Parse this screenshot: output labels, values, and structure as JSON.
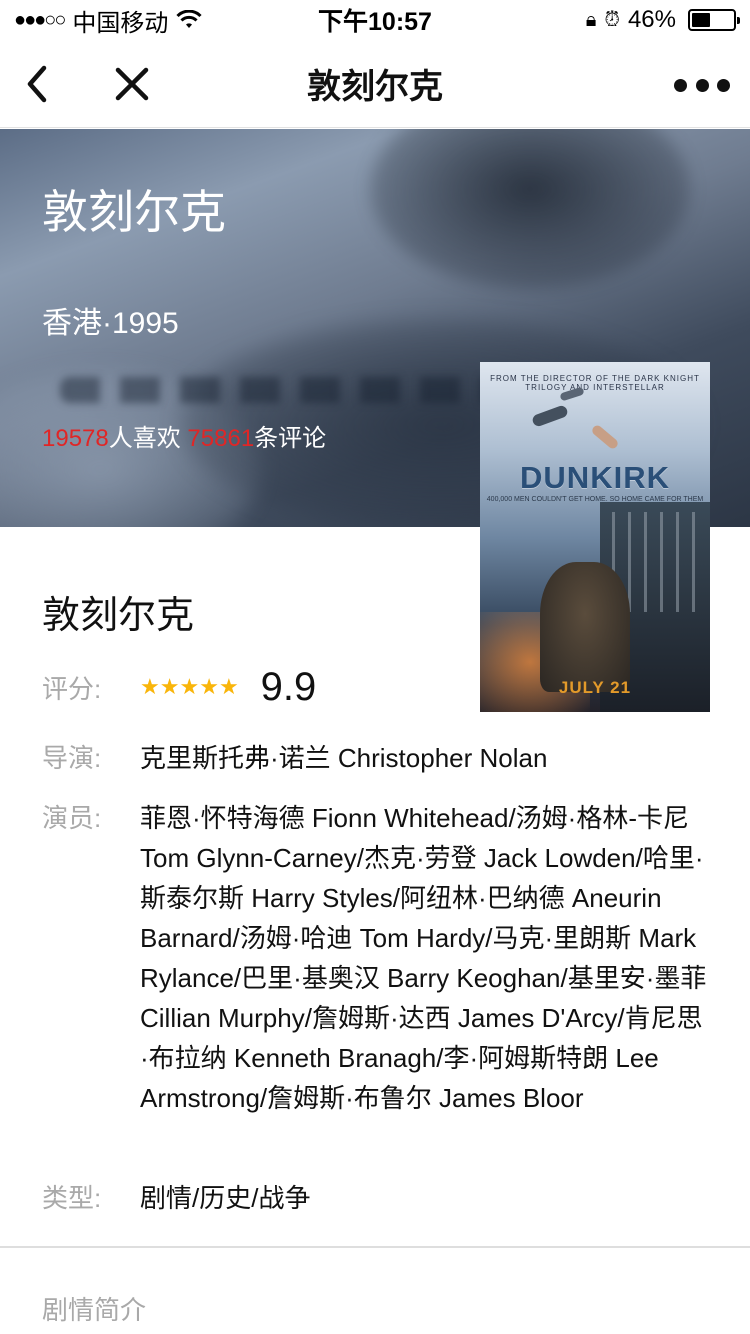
{
  "status_bar": {
    "signal": "●●●○○",
    "carrier": "中国移动",
    "wifi_icon": "wifi-icon",
    "time": "下午10:57",
    "battery_percent": "46%",
    "battery_level": 0.46
  },
  "nav": {
    "title": "敦刻尔克"
  },
  "hero": {
    "title": "敦刻尔克",
    "meta": "香港·1995",
    "likes_count": "19578",
    "likes_label": "人喜欢",
    "comments_count": "75861",
    "comments_label": "条评论"
  },
  "poster": {
    "top_text": "FROM THE DIRECTOR OF THE DARK KNIGHT TRILOGY AND INTERSTELLAR",
    "title": "DUNKIRK",
    "tagline": "400,000 MEN COULDN'T GET HOME. SO HOME CAME FOR THEM",
    "date": "JULY 21"
  },
  "movie": {
    "title": "敦刻尔克",
    "rating_label": "评分:",
    "stars": 5,
    "score": "9.9",
    "director_label": "导演:",
    "director": "克里斯托弗·诺兰 Christopher Nolan",
    "actors_label": "演员:",
    "actors": "菲恩·怀特海德 Fionn Whitehead/汤姆·格林-卡尼 Tom Glynn-Carney/杰克·劳登 Jack Lowden/哈里·斯泰尔斯 Harry Styles/阿纽林·巴纳德 Aneurin Barnard/汤姆·哈迪 Tom Hardy/马克·里朗斯 Mark Rylance/巴里·基奥汉 Barry Keoghan/基里安·墨菲 Cillian Murphy/詹姆斯·达西 James D'Arcy/肯尼思·布拉纳 Kenneth Branagh/李·阿姆斯特朗 Lee Armstrong/詹姆斯·布鲁尔 James Bloor",
    "genre_label": "类型:",
    "genre": "剧情/历史/战争"
  },
  "synopsis": {
    "title": "剧情简介"
  },
  "colors": {
    "accent_red": "#e02626",
    "star_yellow": "#f9b50a",
    "label_gray": "#a9a9a9"
  }
}
